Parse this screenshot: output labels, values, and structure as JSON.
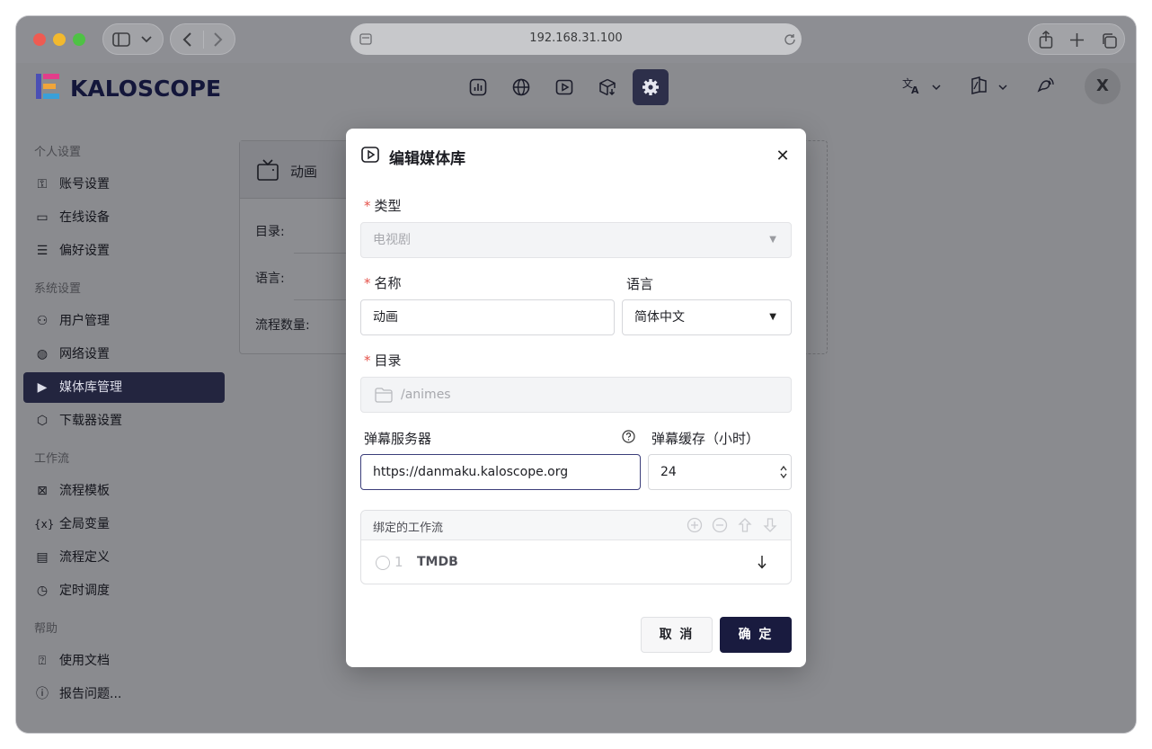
{
  "browser": {
    "url": "192.168.31.100"
  },
  "app": {
    "logo_text": "KALOSCOPE",
    "user_initial": "X"
  },
  "sidebar": {
    "sections": [
      {
        "title": "个人设置"
      },
      {
        "title": "系统设置"
      },
      {
        "title": "工作流"
      },
      {
        "title": "帮助"
      }
    ],
    "items": [
      {
        "label": "账号设置",
        "icon": "user-lock-icon"
      },
      {
        "label": "在线设备",
        "icon": "devices-icon"
      },
      {
        "label": "偏好设置",
        "icon": "preferences-icon"
      },
      {
        "label": "用户管理",
        "icon": "users-icon"
      },
      {
        "label": "网络设置",
        "icon": "globe-icon"
      },
      {
        "label": "媒体库管理",
        "icon": "play-icon"
      },
      {
        "label": "下载器设置",
        "icon": "box-download-icon"
      },
      {
        "label": "流程模板",
        "icon": "template-icon"
      },
      {
        "label": "全局变量",
        "icon": "variable-icon"
      },
      {
        "label": "流程定义",
        "icon": "flow-icon"
      },
      {
        "label": "定时调度",
        "icon": "clock-icon"
      },
      {
        "label": "使用文档",
        "icon": "help-doc-icon"
      },
      {
        "label": "报告问题...",
        "icon": "alert-icon"
      }
    ]
  },
  "card": {
    "title": "动画",
    "rows": [
      "目录:",
      "语言:",
      "流程数量:"
    ]
  },
  "modal": {
    "title": "编辑媒体库",
    "type_label": "类型",
    "type_value": "电视剧",
    "name_label": "名称",
    "name_value": "动画",
    "language_label": "语言",
    "language_value": "简体中文",
    "dir_label": "目录",
    "dir_value": "/animes",
    "danmaku_label": "弹幕服务器",
    "danmaku_value": "https://danmaku.kaloscope.org",
    "cache_label": "弹幕缓存（小时）",
    "cache_value": "24",
    "workflow_title": "绑定的工作流",
    "workflows": [
      {
        "index": "1",
        "name": "TMDB"
      }
    ],
    "cancel_label": "取 消",
    "ok_label": "确 定"
  },
  "colors": {
    "accent": "#191b3f",
    "required": "#e5534b"
  }
}
